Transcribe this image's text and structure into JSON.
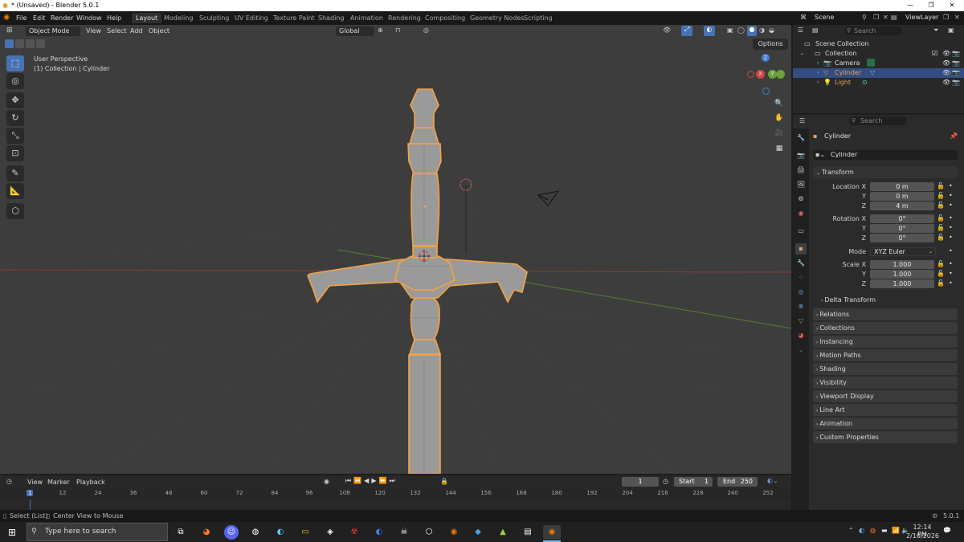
{
  "window": {
    "title": "* (Unsaved) - Blender 5.0.1",
    "minimize": "—",
    "maximize": "❐",
    "close": "✕"
  },
  "menus": [
    "File",
    "Edit",
    "Render",
    "Window",
    "Help"
  ],
  "workspaces": [
    "Layout",
    "Modeling",
    "Sculpting",
    "UV Editing",
    "Texture Paint",
    "Shading",
    "Animation",
    "Rendering",
    "Compositing",
    "Geometry Nodes",
    "Scripting"
  ],
  "active_workspace": "Layout",
  "scene": {
    "label": "Scene",
    "view_layer": "ViewLayer"
  },
  "viewport": {
    "mode": "Object Mode",
    "menus": [
      "View",
      "Select",
      "Add",
      "Object"
    ],
    "orientation": "Global",
    "overlay_text_line1": "User Perspective",
    "overlay_text_line2": "(1) Collection | Cylinder",
    "options_label": "Options",
    "axes": [
      "X",
      "Y",
      "Z"
    ]
  },
  "outliner": {
    "search_placeholder": "Search",
    "root": "Scene Collection",
    "collection": "Collection",
    "items": [
      {
        "name": "Camera",
        "icon": "camera-icon",
        "color": "#e8a35c",
        "selected": false
      },
      {
        "name": "Cylinder",
        "icon": "mesh-icon",
        "color": "#f0a060",
        "selected": true
      },
      {
        "name": "Light",
        "icon": "light-icon",
        "color": "#e8a35c",
        "selected": false
      }
    ]
  },
  "properties": {
    "search_placeholder": "Search",
    "object_name": "Cylinder",
    "data_name": "Cylinder",
    "transform_header": "Transform",
    "location_labels": [
      "Location X",
      "Y",
      "Z"
    ],
    "location_values": [
      "0 m",
      "0 m",
      "4 m"
    ],
    "rotation_labels": [
      "Rotation X",
      "Y",
      "Z"
    ],
    "rotation_values": [
      "0°",
      "0°",
      "0°"
    ],
    "mode_label": "Mode",
    "mode_value": "XYZ Euler",
    "scale_labels": [
      "Scale X",
      "Y",
      "Z"
    ],
    "scale_values": [
      "1.000",
      "1.000",
      "1.000"
    ],
    "delta_transform": "Delta Transform",
    "panels": [
      "Relations",
      "Collections",
      "Instancing",
      "Motion Paths",
      "Shading",
      "Visibility",
      "Viewport Display",
      "Line Art",
      "Animation",
      "Custom Properties"
    ]
  },
  "timeline": {
    "menus": [
      "View",
      "Marker",
      "Playback"
    ],
    "current_frame": "1",
    "start_label": "Start",
    "start": "1",
    "end_label": "End",
    "end": "250",
    "ruler": [
      "1",
      "12",
      "24",
      "36",
      "48",
      "60",
      "72",
      "84",
      "96",
      "108",
      "120",
      "132",
      "144",
      "156",
      "168",
      "180",
      "192",
      "204",
      "216",
      "228",
      "240",
      "252"
    ]
  },
  "statusbar": {
    "left1": "Select (List)",
    "left2": "Center View to Mouse",
    "version": "5.0.1"
  },
  "taskbar": {
    "search_placeholder": "Type here to search",
    "time": "12:14 PM",
    "date": "2/10/2026"
  },
  "colors": {
    "accent": "#4772b3",
    "selection_outline": "#f5a442",
    "viewport_bg": "#3d3d3d",
    "x_axis": "#d04545",
    "y_axis": "#6ba33a",
    "z_axis": "#3f7fd6"
  }
}
